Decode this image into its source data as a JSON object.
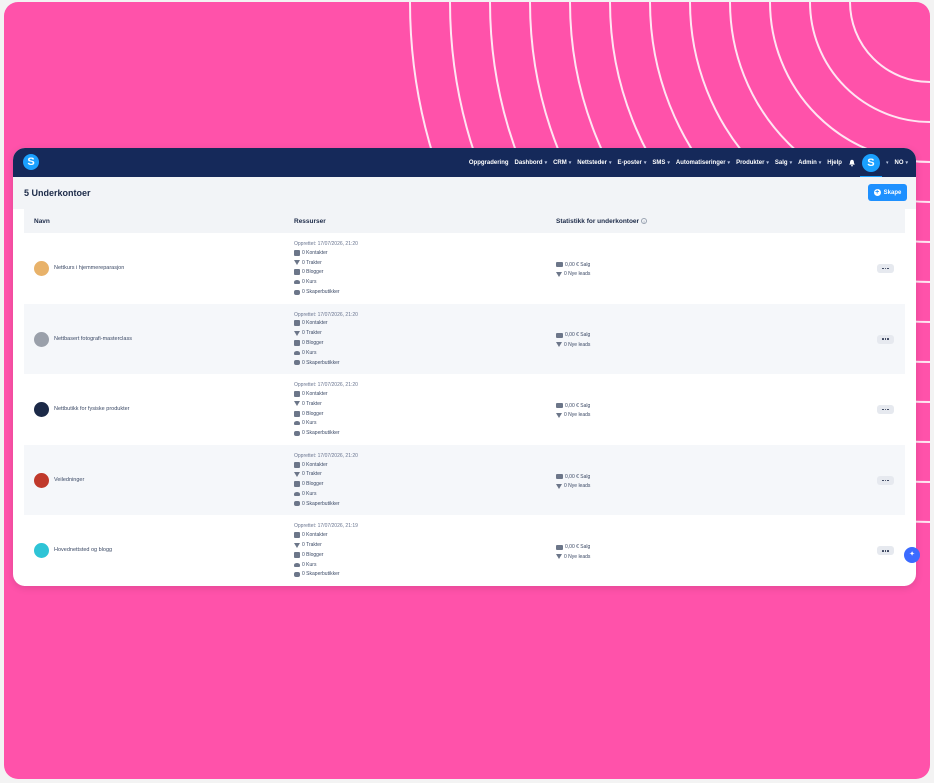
{
  "colors": {
    "background": "#ff52aa",
    "navbar": "#15295a",
    "accent": "#1e90ff",
    "text": "#1c2a48"
  },
  "navbar": {
    "logo": "S",
    "items": [
      {
        "label": "Oppgradering",
        "dropdown": false
      },
      {
        "label": "Dashbord",
        "dropdown": true
      },
      {
        "label": "CRM",
        "dropdown": true
      },
      {
        "label": "Nettsteder",
        "dropdown": true
      },
      {
        "label": "E-poster",
        "dropdown": true
      },
      {
        "label": "SMS",
        "dropdown": true
      },
      {
        "label": "Automatiseringer",
        "dropdown": true
      },
      {
        "label": "Produkter",
        "dropdown": true
      },
      {
        "label": "Salg",
        "dropdown": true
      },
      {
        "label": "Admin",
        "dropdown": true
      },
      {
        "label": "Hjelp",
        "dropdown": false
      }
    ],
    "bell_icon": "bell-icon",
    "avatar_letter": "S",
    "language": "NO"
  },
  "page": {
    "title": "5 Underkontoer",
    "create_button": "Skape"
  },
  "table": {
    "headers": [
      "Navn",
      "Ressurser",
      "Statistikk for underkontoer"
    ],
    "rows": [
      {
        "name": "Nettkurs i hjemmereparasjon",
        "icon": "handyman-icon",
        "icon_color": "#e8b26a",
        "created": "Opprettet: 17/07/2026, 21:20",
        "resources": [
          "0 Kontakter",
          "0 Trakter",
          "0 Blogger",
          "0 Kurs",
          "0 Skaperbutikker"
        ],
        "sales": "0,00 € Salg",
        "leads": "0 Nye leads"
      },
      {
        "name": "Nettbasert fotografi-masterclass",
        "icon": "camera-icon",
        "icon_color": "#9aa0aa",
        "created": "Opprettet: 17/07/2026, 21:20",
        "resources": [
          "0 Kontakter",
          "0 Trakter",
          "0 Blogger",
          "0 Kurs",
          "0 Skaperbutikker"
        ],
        "sales": "0,00 € Salg",
        "leads": "0 Nye leads"
      },
      {
        "name": "Nettbutikk for fysiske produkter",
        "icon": "cart-icon",
        "icon_color": "#1c2a48",
        "created": "Opprettet: 17/07/2026, 21:20",
        "resources": [
          "0 Kontakter",
          "0 Trakter",
          "0 Blogger",
          "0 Kurs",
          "0 Skaperbutikker"
        ],
        "sales": "0,00 € Salg",
        "leads": "0 Nye leads"
      },
      {
        "name": "Veiledninger",
        "icon": "book-icon",
        "icon_color": "#c0392b",
        "created": "Opprettet: 17/07/2026, 21:20",
        "resources": [
          "0 Kontakter",
          "0 Trakter",
          "0 Blogger",
          "0 Kurs",
          "0 Skaperbutikker"
        ],
        "sales": "0,00 € Salg",
        "leads": "0 Nye leads"
      },
      {
        "name": "Hovednettsted og blogg",
        "icon": "chat-icon",
        "icon_color": "#2ec4d6",
        "created": "Opprettet: 17/07/2026, 21:19",
        "resources": [
          "0 Kontakter",
          "0 Trakter",
          "0 Blogger",
          "0 Kurs",
          "0 Skaperbutikker"
        ],
        "sales": "0,00 € Salg",
        "leads": "0 Nye leads"
      }
    ]
  }
}
